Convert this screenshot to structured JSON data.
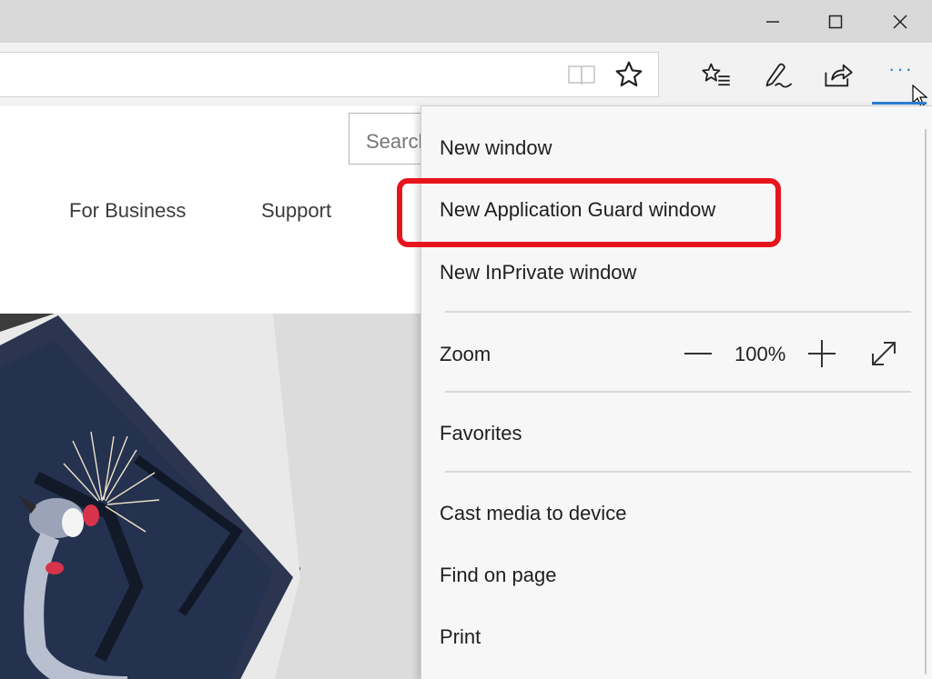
{
  "window_controls": {
    "minimize_icon": "minimize-icon",
    "maximize_icon": "maximize-icon",
    "close_icon": "close-icon"
  },
  "toolbar": {
    "reading_view_icon": "book-icon",
    "favorite_icon": "star-icon",
    "hub_icon": "favorites-list-icon",
    "notes_icon": "pen-icon",
    "share_icon": "share-icon",
    "more_label": "···",
    "accent_color": "#2b7fd4"
  },
  "page": {
    "search_placeholder": "Search",
    "nav_links": [
      "For Business",
      "Support"
    ]
  },
  "menu": {
    "items": {
      "new_window": "New window",
      "new_app_guard": "New Application Guard window",
      "new_inprivate": "New InPrivate window",
      "zoom": "Zoom",
      "zoom_value": "100%",
      "favorites": "Favorites",
      "cast": "Cast media to device",
      "find": "Find on page",
      "print": "Print"
    },
    "highlight_color": "#e8141c"
  }
}
